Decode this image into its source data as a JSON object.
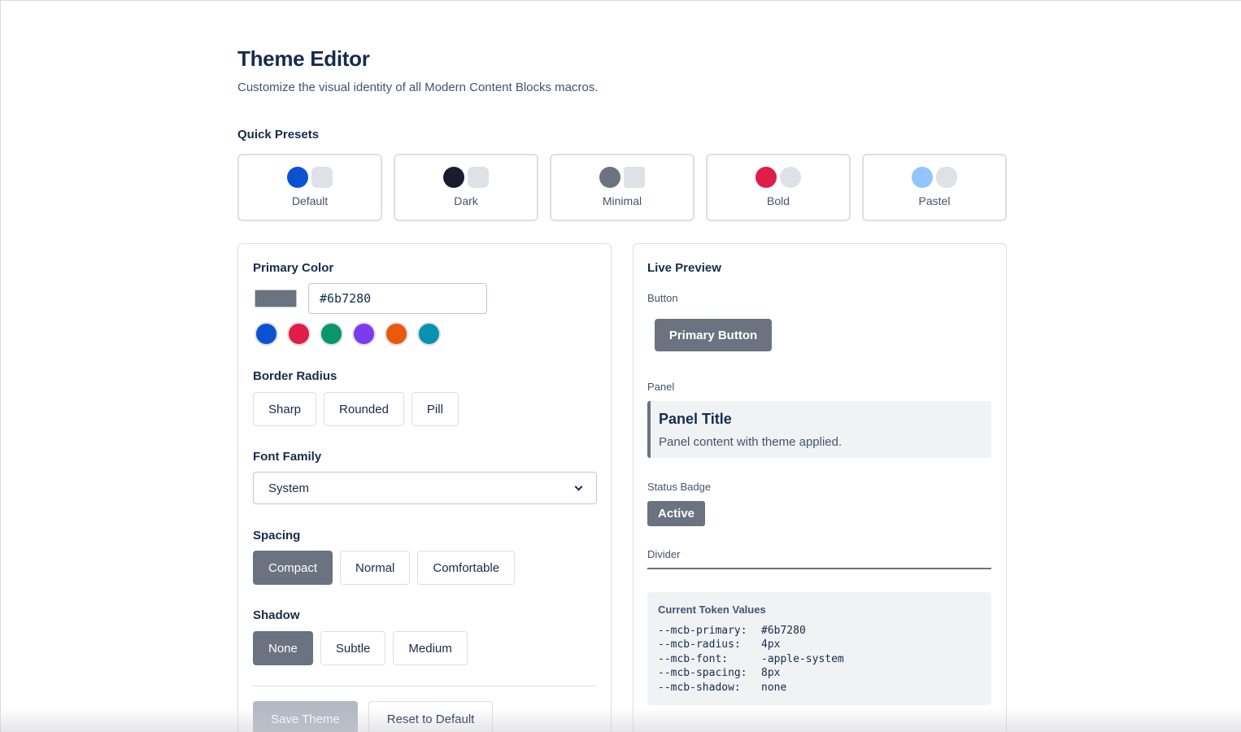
{
  "header": {
    "title": "Theme Editor",
    "subtitle": "Customize the visual identity of all Modern Content Blocks macros."
  },
  "presets": {
    "label": "Quick Presets",
    "items": [
      {
        "name": "Default",
        "primary": "#0c52d0",
        "secondary": "#dfe1e6"
      },
      {
        "name": "Dark",
        "primary": "#1c1b2e",
        "secondary": "#dfe1e6"
      },
      {
        "name": "Minimal",
        "primary": "#6b7280",
        "secondary": "#dfe1e6"
      },
      {
        "name": "Bold",
        "primary": "#e01d47",
        "secondary": "#dfe1e6"
      },
      {
        "name": "Pastel",
        "primary": "#93c5fd",
        "secondary": "#dfe1e6"
      }
    ]
  },
  "editor": {
    "primary_color": {
      "label": "Primary Color",
      "value": "#6b7280",
      "swatches": [
        "#0c52d0",
        "#e01d47",
        "#059669",
        "#7c3aed",
        "#ea580c",
        "#0891b2"
      ]
    },
    "border_radius": {
      "label": "Border Radius",
      "options": [
        "Sharp",
        "Rounded",
        "Pill"
      ]
    },
    "font_family": {
      "label": "Font Family",
      "value": "System"
    },
    "spacing": {
      "label": "Spacing",
      "options": [
        "Compact",
        "Normal",
        "Comfortable"
      ],
      "selected": "Compact"
    },
    "shadow": {
      "label": "Shadow",
      "options": [
        "None",
        "Subtle",
        "Medium"
      ],
      "selected": "None"
    },
    "actions": {
      "save": "Save Theme",
      "reset": "Reset to Default"
    }
  },
  "preview": {
    "title": "Live Preview",
    "button_label": "Button",
    "button_text": "Primary Button",
    "panel_label": "Panel",
    "panel_title": "Panel Title",
    "panel_body": "Panel content with theme applied.",
    "badge_label": "Status Badge",
    "badge_text": "Active",
    "divider_label": "Divider",
    "tokens": {
      "title": "Current Token Values",
      "rows": [
        {
          "key": "--mcb-primary:",
          "value": "#6b7280"
        },
        {
          "key": "--mcb-radius:",
          "value": "4px"
        },
        {
          "key": "--mcb-font:",
          "value": "-apple-system"
        },
        {
          "key": "--mcb-spacing:",
          "value": "8px"
        },
        {
          "key": "--mcb-shadow:",
          "value": "none"
        }
      ]
    }
  },
  "colors": {
    "accent": "#6b7280",
    "text": "#172b4d",
    "muted": "#44546f",
    "border": "#dcdfe4"
  }
}
